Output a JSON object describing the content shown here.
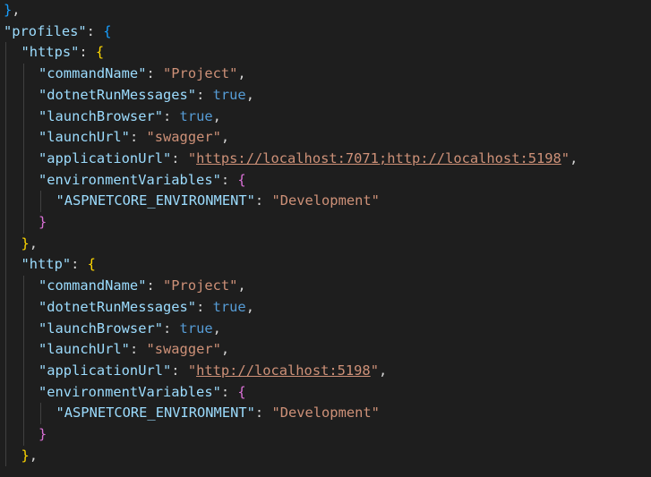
{
  "lines": [
    {
      "indent": 0,
      "tokens": [
        {
          "t": "}",
          "c": "b2"
        },
        {
          "t": ",",
          "c": "punc"
        }
      ]
    },
    {
      "indent": 0,
      "tokens": [
        {
          "t": "\"profiles\"",
          "c": "key"
        },
        {
          "t": ": ",
          "c": "punc"
        },
        {
          "t": "{",
          "c": "b2"
        }
      ]
    },
    {
      "indent": 1,
      "tokens": [
        {
          "t": "\"https\"",
          "c": "key"
        },
        {
          "t": ": ",
          "c": "punc"
        },
        {
          "t": "{",
          "c": "b3"
        }
      ]
    },
    {
      "indent": 2,
      "tokens": [
        {
          "t": "\"commandName\"",
          "c": "key"
        },
        {
          "t": ": ",
          "c": "punc"
        },
        {
          "t": "\"Project\"",
          "c": "str"
        },
        {
          "t": ",",
          "c": "punc"
        }
      ]
    },
    {
      "indent": 2,
      "tokens": [
        {
          "t": "\"dotnetRunMessages\"",
          "c": "key"
        },
        {
          "t": ": ",
          "c": "punc"
        },
        {
          "t": "true",
          "c": "kw"
        },
        {
          "t": ",",
          "c": "punc"
        }
      ]
    },
    {
      "indent": 2,
      "tokens": [
        {
          "t": "\"launchBrowser\"",
          "c": "key"
        },
        {
          "t": ": ",
          "c": "punc"
        },
        {
          "t": "true",
          "c": "kw"
        },
        {
          "t": ",",
          "c": "punc"
        }
      ]
    },
    {
      "indent": 2,
      "tokens": [
        {
          "t": "\"launchUrl\"",
          "c": "key"
        },
        {
          "t": ": ",
          "c": "punc"
        },
        {
          "t": "\"swagger\"",
          "c": "str"
        },
        {
          "t": ",",
          "c": "punc"
        }
      ]
    },
    {
      "indent": 2,
      "tokens": [
        {
          "t": "\"applicationUrl\"",
          "c": "key"
        },
        {
          "t": ": ",
          "c": "punc"
        },
        {
          "t": "\"",
          "c": "str"
        },
        {
          "t": "https://localhost:7071;http://localhost:5198",
          "c": "str link"
        },
        {
          "t": "\"",
          "c": "str"
        },
        {
          "t": ",",
          "c": "punc"
        }
      ]
    },
    {
      "indent": 2,
      "tokens": [
        {
          "t": "\"environmentVariables\"",
          "c": "key"
        },
        {
          "t": ": ",
          "c": "punc"
        },
        {
          "t": "{",
          "c": "b1"
        }
      ]
    },
    {
      "indent": 3,
      "tokens": [
        {
          "t": "\"ASPNETCORE_ENVIRONMENT\"",
          "c": "key"
        },
        {
          "t": ": ",
          "c": "punc"
        },
        {
          "t": "\"Development\"",
          "c": "str"
        }
      ]
    },
    {
      "indent": 2,
      "tokens": [
        {
          "t": "}",
          "c": "b1"
        }
      ]
    },
    {
      "indent": 1,
      "tokens": [
        {
          "t": "}",
          "c": "b3"
        },
        {
          "t": ",",
          "c": "punc"
        }
      ]
    },
    {
      "indent": 1,
      "tokens": [
        {
          "t": "\"http\"",
          "c": "key"
        },
        {
          "t": ": ",
          "c": "punc"
        },
        {
          "t": "{",
          "c": "b3"
        }
      ]
    },
    {
      "indent": 2,
      "tokens": [
        {
          "t": "\"commandName\"",
          "c": "key"
        },
        {
          "t": ": ",
          "c": "punc"
        },
        {
          "t": "\"Project\"",
          "c": "str"
        },
        {
          "t": ",",
          "c": "punc"
        }
      ]
    },
    {
      "indent": 2,
      "tokens": [
        {
          "t": "\"dotnetRunMessages\"",
          "c": "key"
        },
        {
          "t": ": ",
          "c": "punc"
        },
        {
          "t": "true",
          "c": "kw"
        },
        {
          "t": ",",
          "c": "punc"
        }
      ]
    },
    {
      "indent": 2,
      "tokens": [
        {
          "t": "\"launchBrowser\"",
          "c": "key"
        },
        {
          "t": ": ",
          "c": "punc"
        },
        {
          "t": "true",
          "c": "kw"
        },
        {
          "t": ",",
          "c": "punc"
        }
      ]
    },
    {
      "indent": 2,
      "tokens": [
        {
          "t": "\"launchUrl\"",
          "c": "key"
        },
        {
          "t": ": ",
          "c": "punc"
        },
        {
          "t": "\"swagger\"",
          "c": "str"
        },
        {
          "t": ",",
          "c": "punc"
        }
      ]
    },
    {
      "indent": 2,
      "tokens": [
        {
          "t": "\"applicationUrl\"",
          "c": "key"
        },
        {
          "t": ": ",
          "c": "punc"
        },
        {
          "t": "\"",
          "c": "str"
        },
        {
          "t": "http://localhost:5198",
          "c": "str link"
        },
        {
          "t": "\"",
          "c": "str"
        },
        {
          "t": ",",
          "c": "punc"
        }
      ]
    },
    {
      "indent": 2,
      "tokens": [
        {
          "t": "\"environmentVariables\"",
          "c": "key"
        },
        {
          "t": ": ",
          "c": "punc"
        },
        {
          "t": "{",
          "c": "b1"
        }
      ]
    },
    {
      "indent": 3,
      "tokens": [
        {
          "t": "\"ASPNETCORE_ENVIRONMENT\"",
          "c": "key"
        },
        {
          "t": ": ",
          "c": "punc"
        },
        {
          "t": "\"Development\"",
          "c": "str"
        }
      ]
    },
    {
      "indent": 2,
      "tokens": [
        {
          "t": "}",
          "c": "b1"
        }
      ]
    },
    {
      "indent": 1,
      "tokens": [
        {
          "t": "}",
          "c": "b3"
        },
        {
          "t": ",",
          "c": "punc"
        }
      ]
    }
  ],
  "colors": {
    "background": "#1e1e1e",
    "key": "#9cdcfe",
    "string": "#ce9178",
    "keyword": "#569cd6",
    "bracket_level_1": "#179fff",
    "bracket_level_2": "#ffd700",
    "bracket_level_3": "#da70d6",
    "indent_guide": "#404040"
  }
}
